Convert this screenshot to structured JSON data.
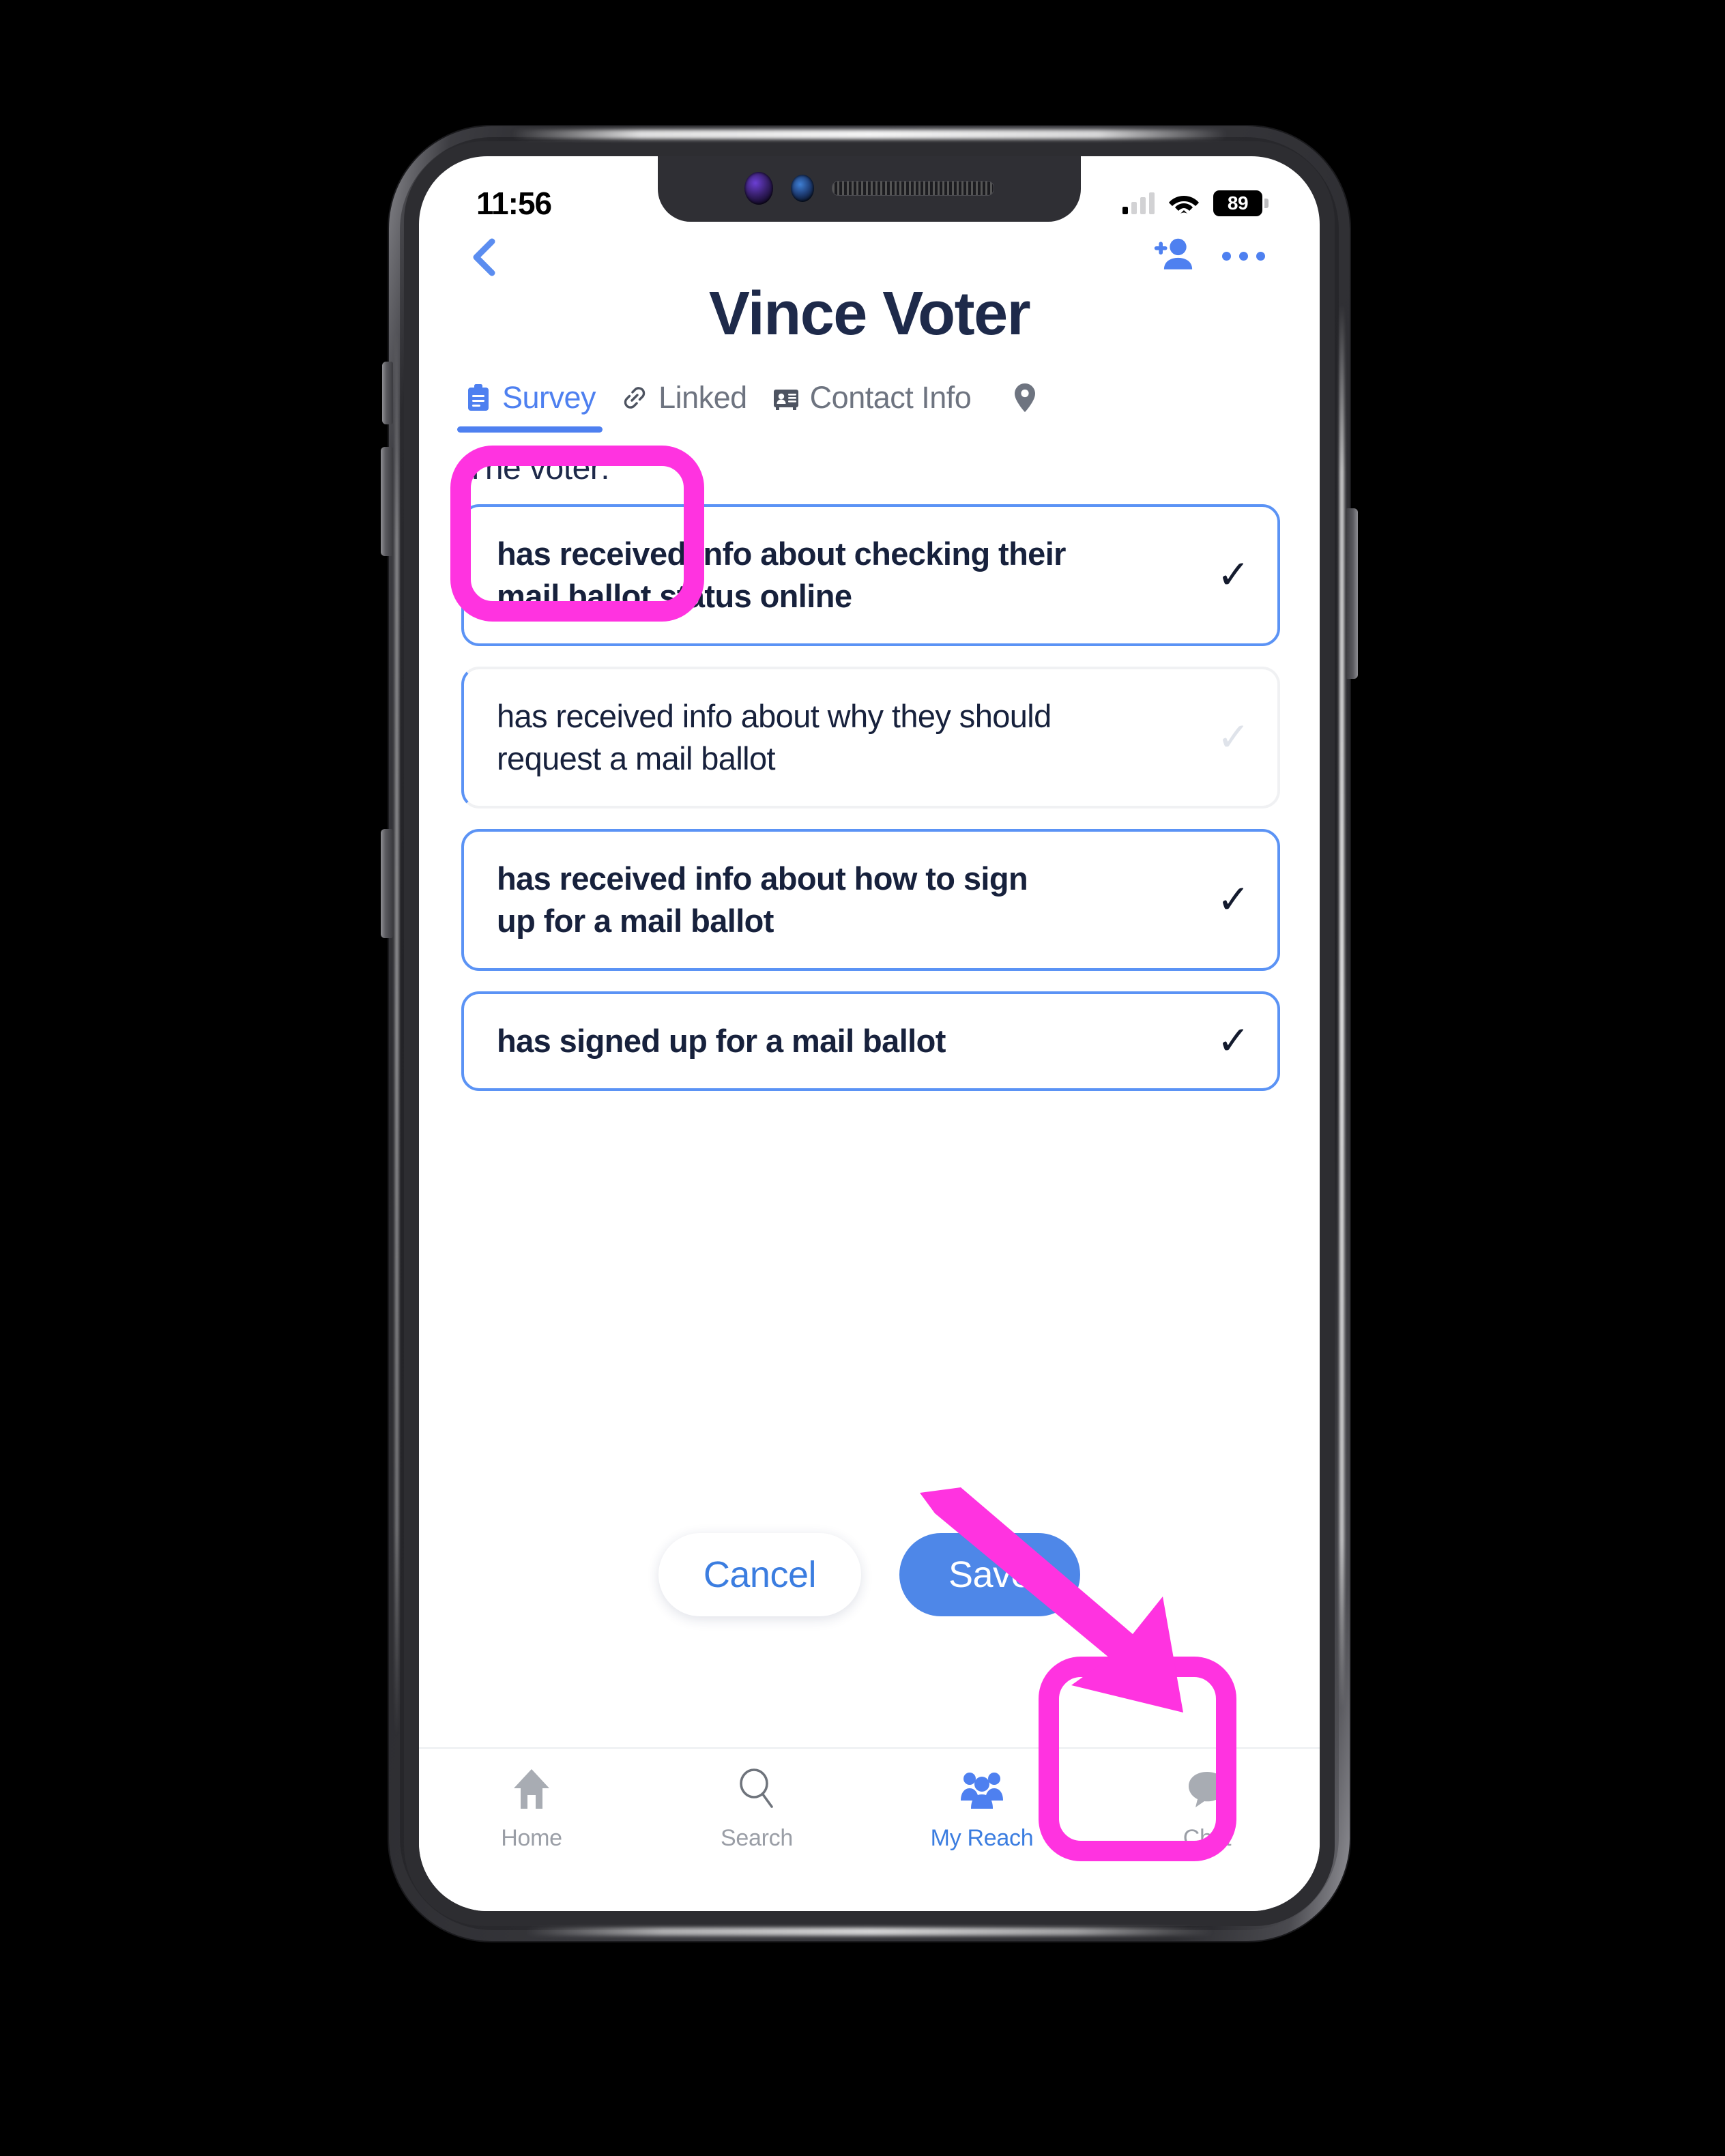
{
  "status_bar": {
    "time": "11:56",
    "battery_level": "89",
    "signal_icon": "cellular-signal-icon",
    "wifi_icon": "wifi-icon",
    "battery_icon": "battery-icon"
  },
  "header": {
    "back_icon": "back-chevron-icon",
    "add_person_icon": "add-person-icon",
    "more_icon": "more-options-icon",
    "title": "Vince Voter"
  },
  "tabs": [
    {
      "label": "Survey",
      "icon": "clipboard-icon",
      "active": true
    },
    {
      "label": "Linked",
      "icon": "link-icon",
      "active": false
    },
    {
      "label": "Contact Info",
      "icon": "contact-card-icon",
      "active": false
    },
    {
      "label": "",
      "icon": "location-pin-icon",
      "active": false
    }
  ],
  "content": {
    "section_label": "The voter:",
    "cards": [
      {
        "text": "has received info about checking their mail ballot status online",
        "checked": true
      },
      {
        "text": "has received info about why they should request a mail ballot",
        "checked": false
      },
      {
        "text": "has received info about how to sign up for a mail ballot",
        "checked": true
      },
      {
        "text": "has signed up for a mail ballot",
        "checked": true
      }
    ],
    "check_glyph": "✓"
  },
  "actions": {
    "cancel_label": "Cancel",
    "save_label": "Save"
  },
  "bottom_nav": [
    {
      "label": "Home",
      "icon": "home-icon",
      "active": false
    },
    {
      "label": "Search",
      "icon": "search-icon",
      "active": false
    },
    {
      "label": "My Reach",
      "icon": "people-group-icon",
      "active": true
    },
    {
      "label": "Chat",
      "icon": "chat-bubble-icon",
      "active": false
    }
  ],
  "annotations": {
    "highlight_color": "#ff33e0",
    "survey_tab_highlight": "rounded-rect-highlight",
    "save_button_highlight": "rounded-rect-highlight",
    "pointer": "arrow-pointing-to-save"
  },
  "colors": {
    "accent_blue": "#4e80f0",
    "title_navy": "#1e2a4a",
    "card_border": "#5b93f5",
    "save_bg": "#4e87e8",
    "annotation_pink": "#ff33e0"
  }
}
